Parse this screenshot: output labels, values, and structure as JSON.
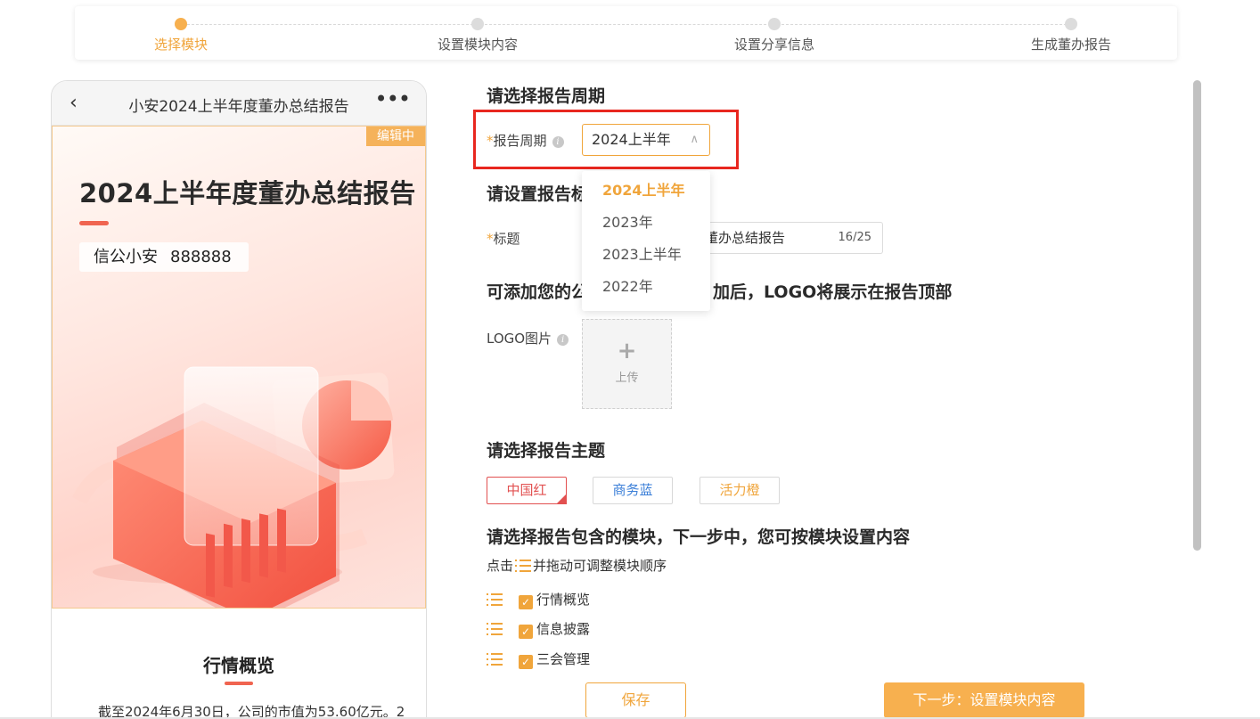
{
  "steps": [
    {
      "label": "选择模块",
      "active": true
    },
    {
      "label": "设置模块内容",
      "active": false
    },
    {
      "label": "设置分享信息",
      "active": false
    },
    {
      "label": "生成董办报告",
      "active": false
    }
  ],
  "preview": {
    "header_title": "小安2024上半年度董办总结报告",
    "edit_tag": "编辑中",
    "cover_title": "2024上半年度董办总结报告",
    "company_name": "信公小安",
    "company_code": "888888",
    "section_title": "行情概览",
    "section_text": "截至2024年6月30日，公司的市值为53.60亿元。2"
  },
  "form": {
    "period_heading": "请选择报告周期",
    "period_label": "报告周期",
    "period_value": "2024上半年",
    "period_options": [
      "2024上半年",
      "2023年",
      "2023上半年",
      "2022年"
    ],
    "title_heading": "请设置报告标题",
    "title_heading_visible": "请设置报告标",
    "title_label": "标题",
    "title_value": "董办总结报告",
    "title_count": "16/25",
    "logo_heading_left": "可添加您的公",
    "logo_heading_right": "加后，LOGO将展示在报告顶部",
    "logo_label": "LOGO图片",
    "upload_label": "上传",
    "theme_heading": "请选择报告主题",
    "themes": [
      "中国红",
      "商务蓝",
      "活力橙"
    ],
    "selected_theme": "中国红",
    "modules_heading": "请选择报告包含的模块，下一步中，您可按模块设置内容",
    "modules_hint_prefix": "点击",
    "modules_hint_suffix": "并拖动可调整模块顺序",
    "modules": [
      {
        "label": "行情概览",
        "checked": true
      },
      {
        "label": "信息披露",
        "checked": true
      },
      {
        "label": "三会管理",
        "checked": true
      }
    ]
  },
  "footer": {
    "save_label": "保存",
    "next_label": "下一步：设置模块内容"
  },
  "colors": {
    "accent": "#f0a53b",
    "highlight_box": "#e8271f",
    "theme_red": "#e25050",
    "theme_blue": "#3b7fd8"
  }
}
